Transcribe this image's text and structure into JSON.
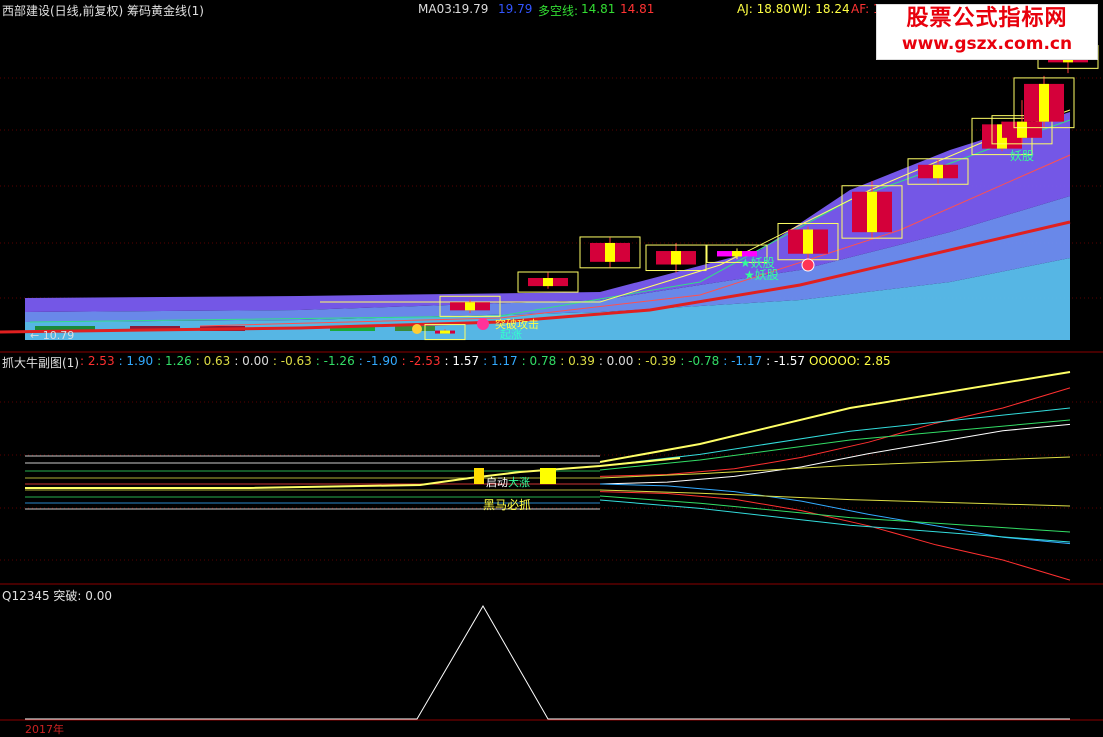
{
  "header": {
    "title": "西部建设(日线,前复权) 筹码黄金线(1)",
    "ma03_label": "MA03:",
    "ma03_value1": "19.79",
    "ma03_value2": "19.79",
    "dkx_label": "多空线:",
    "dkx_value1": "14.81",
    "dkx_value2": "14.81",
    "aj": "AJ: 18.80",
    "wj": "WJ: 18.24",
    "af": "AF: 1"
  },
  "watermark": {
    "line1": "股票公式指标网",
    "line2": "www.gszx.com.cn"
  },
  "main_panel": {
    "low_price_label": "← 10.79",
    "tags": [
      "妖股",
      "★妖股",
      "★妖股",
      "突破攻击",
      "起涨"
    ]
  },
  "sub_panel": {
    "title": "抓大牛副图(1)",
    "values": [
      {
        "text": ": 2.53",
        "color": "#ff3030"
      },
      {
        "text": ": 1.90",
        "color": "#33aaff"
      },
      {
        "text": ": 1.26",
        "color": "#33dd66"
      },
      {
        "text": ": 0.63",
        "color": "#dddd44"
      },
      {
        "text": ": 0.00",
        "color": "#dddddd"
      },
      {
        "text": ": -0.63",
        "color": "#dddd44"
      },
      {
        "text": ": -1.26",
        "color": "#33dd66"
      },
      {
        "text": ": -1.90",
        "color": "#33aaff"
      },
      {
        "text": ": -2.53",
        "color": "#ff3030"
      },
      {
        "text": ": 1.57",
        "color": "#ffffff"
      },
      {
        "text": ": 1.17",
        "color": "#33aaff"
      },
      {
        "text": ": 0.78",
        "color": "#33dd66"
      },
      {
        "text": ": 0.39",
        "color": "#dddd44"
      },
      {
        "text": ": 0.00",
        "color": "#dddddd"
      },
      {
        "text": ": -0.39",
        "color": "#dddd44"
      },
      {
        "text": ": -0.78",
        "color": "#33dd66"
      },
      {
        "text": ": -1.17",
        "color": "#33aaff"
      },
      {
        "text": ": -1.57",
        "color": "#ffffff"
      },
      {
        "text": "OOOOO: 2.85",
        "color": "#ffff44"
      }
    ],
    "tags": [
      "黑马必抓",
      "启动",
      "大涨"
    ]
  },
  "bottom_panel": {
    "title": "Q12345 突破: 0.00",
    "year_label": "2017年"
  },
  "chart_data": {
    "type": "candlestick",
    "panels": [
      {
        "name": "筹码黄金线(1)",
        "type": "candlestick",
        "ohlc": [
          {
            "o": 10.8,
            "h": 10.9,
            "l": 10.79,
            "c": 10.85
          },
          {
            "o": 11.6,
            "h": 12.0,
            "l": 11.5,
            "c": 11.9
          },
          {
            "o": 12.5,
            "h": 13.0,
            "l": 12.4,
            "c": 12.8
          },
          {
            "o": 13.4,
            "h": 14.3,
            "l": 13.2,
            "c": 14.1
          },
          {
            "o": 13.3,
            "h": 14.1,
            "l": 13.0,
            "c": 13.8
          },
          {
            "o": 13.8,
            "h": 13.9,
            "l": 13.5,
            "c": 13.6
          },
          {
            "o": 13.7,
            "h": 14.7,
            "l": 13.5,
            "c": 14.6
          },
          {
            "o": 14.5,
            "h": 16.4,
            "l": 14.3,
            "c": 16.0
          },
          {
            "o": 16.5,
            "h": 17.2,
            "l": 16.3,
            "c": 17.0
          },
          {
            "o": 17.6,
            "h": 18.6,
            "l": 17.5,
            "c": 18.5
          },
          {
            "o": 18.0,
            "h": 19.4,
            "l": 17.8,
            "c": 18.6
          },
          {
            "o": 18.6,
            "h": 20.3,
            "l": 18.4,
            "c": 20.0
          },
          {
            "o": 20.8,
            "h": 21.5,
            "l": 20.4,
            "c": 21.2
          }
        ]
      },
      {
        "name": "抓大牛副图(1)",
        "type": "line",
        "series": [
          {
            "name": "",
            "values": [
              0.2,
              0.25,
              0.4,
              0.7,
              1.1,
              1.6,
              2.0,
              2.53
            ]
          },
          {
            "name": "",
            "values": [
              0.0,
              0.05,
              0.2,
              0.45,
              0.8,
              1.1,
              1.4,
              1.57
            ]
          },
          {
            "name": "",
            "values": [
              0.0,
              -0.05,
              -0.2,
              -0.45,
              -0.8,
              -1.1,
              -1.4,
              -1.57
            ]
          },
          {
            "name": "",
            "values": [
              -0.2,
              -0.25,
              -0.4,
              -0.7,
              -1.1,
              -1.6,
              -2.0,
              -2.53
            ]
          }
        ]
      },
      {
        "name": "Q12345",
        "type": "line",
        "series": [
          {
            "name": "突破",
            "values": [
              0,
              0,
              0,
              0,
              1,
              0,
              0,
              0,
              0,
              0,
              0,
              0
            ]
          }
        ]
      }
    ]
  }
}
